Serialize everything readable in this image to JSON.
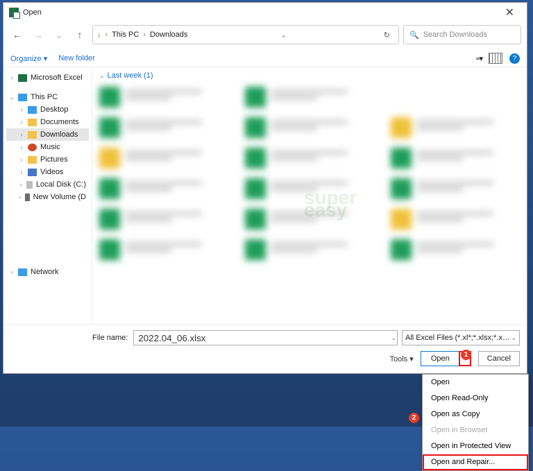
{
  "title": "Open",
  "nav": {
    "up": "↑"
  },
  "address": {
    "root": "This PC",
    "sep": "›",
    "folder": "Downloads"
  },
  "search": {
    "placeholder": "Search Downloads"
  },
  "toolbar": {
    "organize": "Organize ▾",
    "newfolder": "New folder",
    "help": "?"
  },
  "tree": {
    "excel": "Microsoft Excel",
    "thispc": "This PC",
    "desktop": "Desktop",
    "documents": "Documents",
    "downloads": "Downloads",
    "music": "Music",
    "pictures": "Pictures",
    "videos": "Videos",
    "localdisk": "Local Disk (C:)",
    "newvolume": "New Volume (D",
    "network": "Network"
  },
  "content": {
    "group": "Last week (1)"
  },
  "footer": {
    "filelabel": "File name:",
    "filename": "2022.04_06.xlsx",
    "filetype": "All Excel Files (*.xl*;*.xlsx;*.xlsm",
    "tools": "Tools    ▾",
    "open": "Open",
    "opendd": "▾",
    "cancel": "Cancel"
  },
  "menu": {
    "open": "Open",
    "readonly": "Open Read-Only",
    "copy": "Open as Copy",
    "browser": "Open in Browser",
    "protected": "Open in Protected View",
    "repair": "Open and Repair..."
  },
  "markers": {
    "m1": "1",
    "m2": "2"
  },
  "watermark": {
    "a": "super",
    "b": "easy"
  }
}
